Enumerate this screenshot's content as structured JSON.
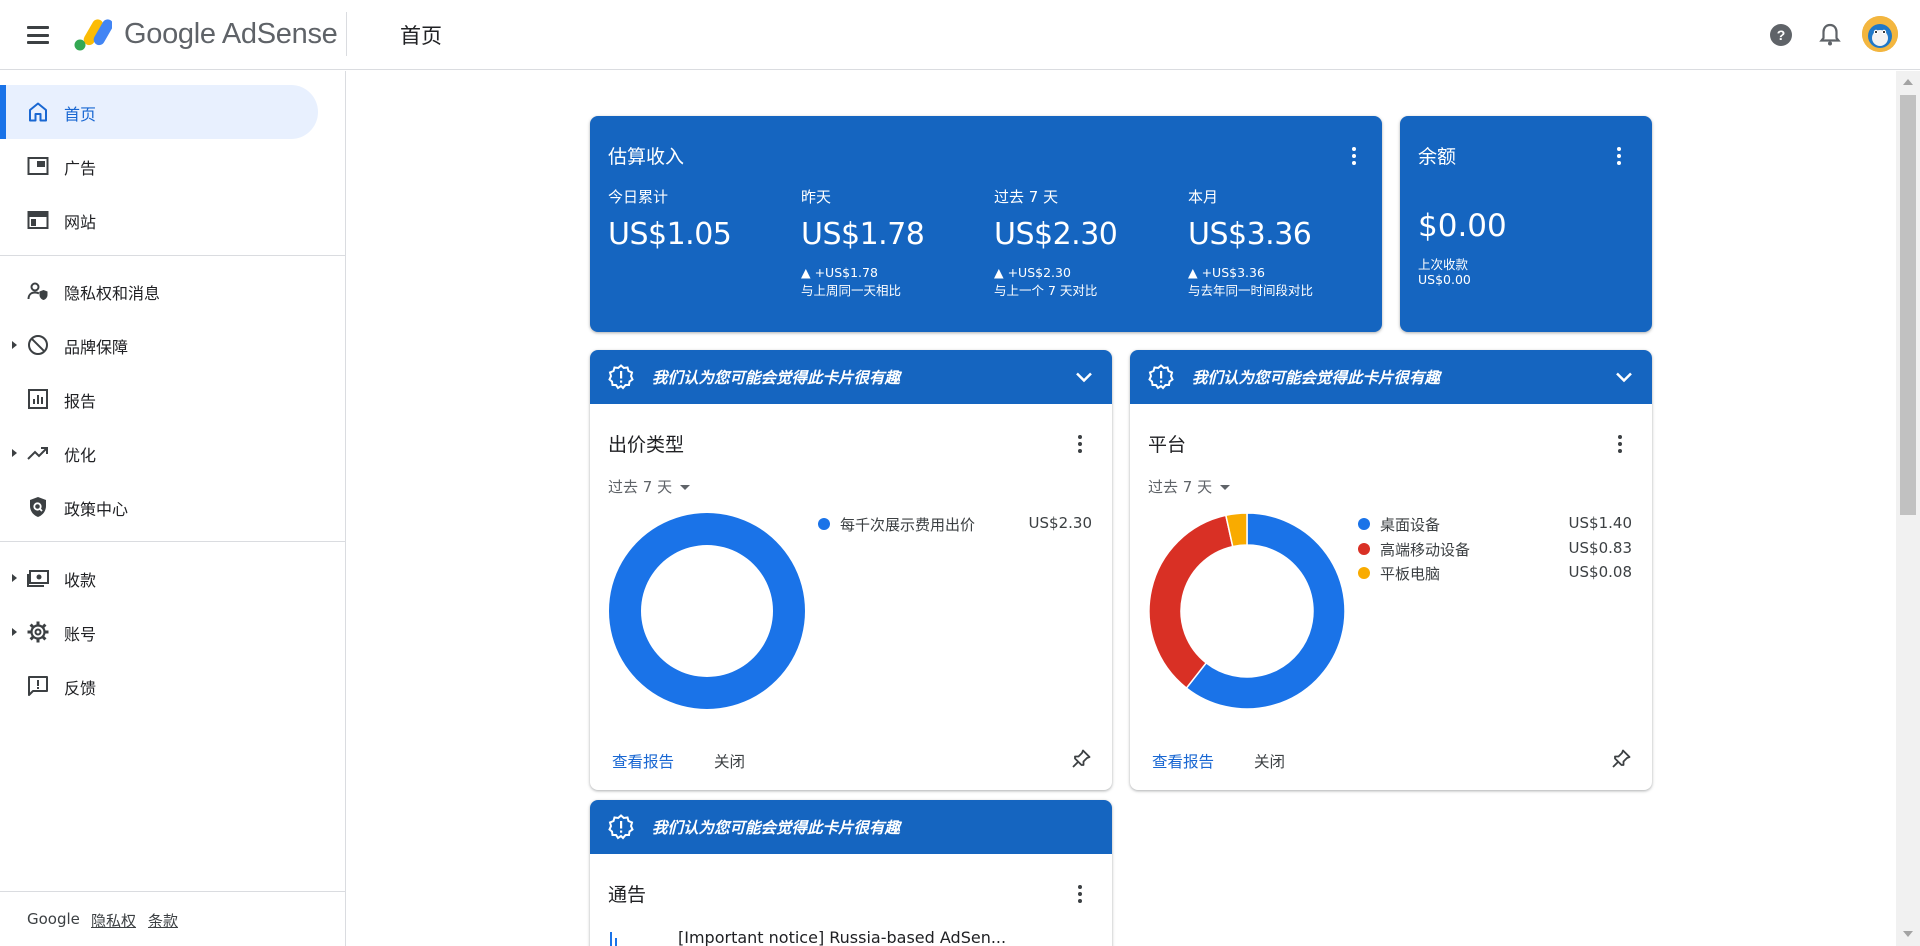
{
  "app": {
    "brand": "Google AdSense",
    "page_title": "首页"
  },
  "colors": {
    "accent": "#1565c0",
    "blue": "#1a73e8",
    "red": "#d93025",
    "yellow": "#f9ab00"
  },
  "sidebar": {
    "items": [
      {
        "label": "首页",
        "icon": "home-icon",
        "active": true
      },
      {
        "label": "广告",
        "icon": "ads-icon"
      },
      {
        "label": "网站",
        "icon": "sites-icon"
      },
      {
        "label": "隐私权和消息",
        "icon": "privacy-icon"
      },
      {
        "label": "品牌保障",
        "icon": "block-icon",
        "expandable": true
      },
      {
        "label": "报告",
        "icon": "reports-icon"
      },
      {
        "label": "优化",
        "icon": "trending-icon",
        "expandable": true
      },
      {
        "label": "政策中心",
        "icon": "policy-shield-icon"
      },
      {
        "label": "收款",
        "icon": "payments-icon",
        "expandable": true
      },
      {
        "label": "账号",
        "icon": "gear-icon",
        "expandable": true
      },
      {
        "label": "反馈",
        "icon": "feedback-icon"
      }
    ],
    "footer": {
      "google": "Google",
      "privacy": "隐私权",
      "terms": "条款"
    }
  },
  "earnings": {
    "title": "估算收入",
    "stats": [
      {
        "label": "今日累计",
        "value": "US$1.05",
        "delta": "",
        "compare": ""
      },
      {
        "label": "昨天",
        "value": "US$1.78",
        "delta": "▲ +US$1.78",
        "compare": "与上周同一天相比"
      },
      {
        "label": "过去 7 天",
        "value": "US$2.30",
        "delta": "▲ +US$2.30",
        "compare": "与上一个 7 天对比"
      },
      {
        "label": "本月",
        "value": "US$3.36",
        "delta": "▲ +US$3.36",
        "compare": "与去年同一时间段对比"
      }
    ]
  },
  "balance": {
    "title": "余额",
    "value": "$0.00",
    "last_payment_label": "上次收款",
    "last_payment_value": "US$0.00"
  },
  "banner_text": "我们认为您可能会觉得此卡片很有趣",
  "bid_card": {
    "title": "出价类型",
    "period": "过去 7 天",
    "legend": [
      {
        "label": "每千次展示费用出价",
        "value": "US$2.30"
      }
    ],
    "view_report": "查看报告",
    "close": "关闭"
  },
  "platform_card": {
    "title": "平台",
    "period": "过去 7 天",
    "legend": [
      {
        "label": "桌面设备",
        "value": "US$1.40"
      },
      {
        "label": "高端移动设备",
        "value": "US$0.83"
      },
      {
        "label": "平板电脑",
        "value": "US$0.08"
      }
    ],
    "view_report": "查看报告",
    "close": "关闭"
  },
  "notice_card": {
    "title": "通告",
    "item": "[Important notice] Russia-based AdSen..."
  },
  "chart_data": [
    {
      "type": "pie",
      "title": "出价类型",
      "categories": [
        "每千次展示费用出价"
      ],
      "values": [
        2.3
      ]
    },
    {
      "type": "pie",
      "title": "平台",
      "categories": [
        "桌面设备",
        "高端移动设备",
        "平板电脑"
      ],
      "values": [
        1.4,
        0.83,
        0.08
      ]
    }
  ]
}
